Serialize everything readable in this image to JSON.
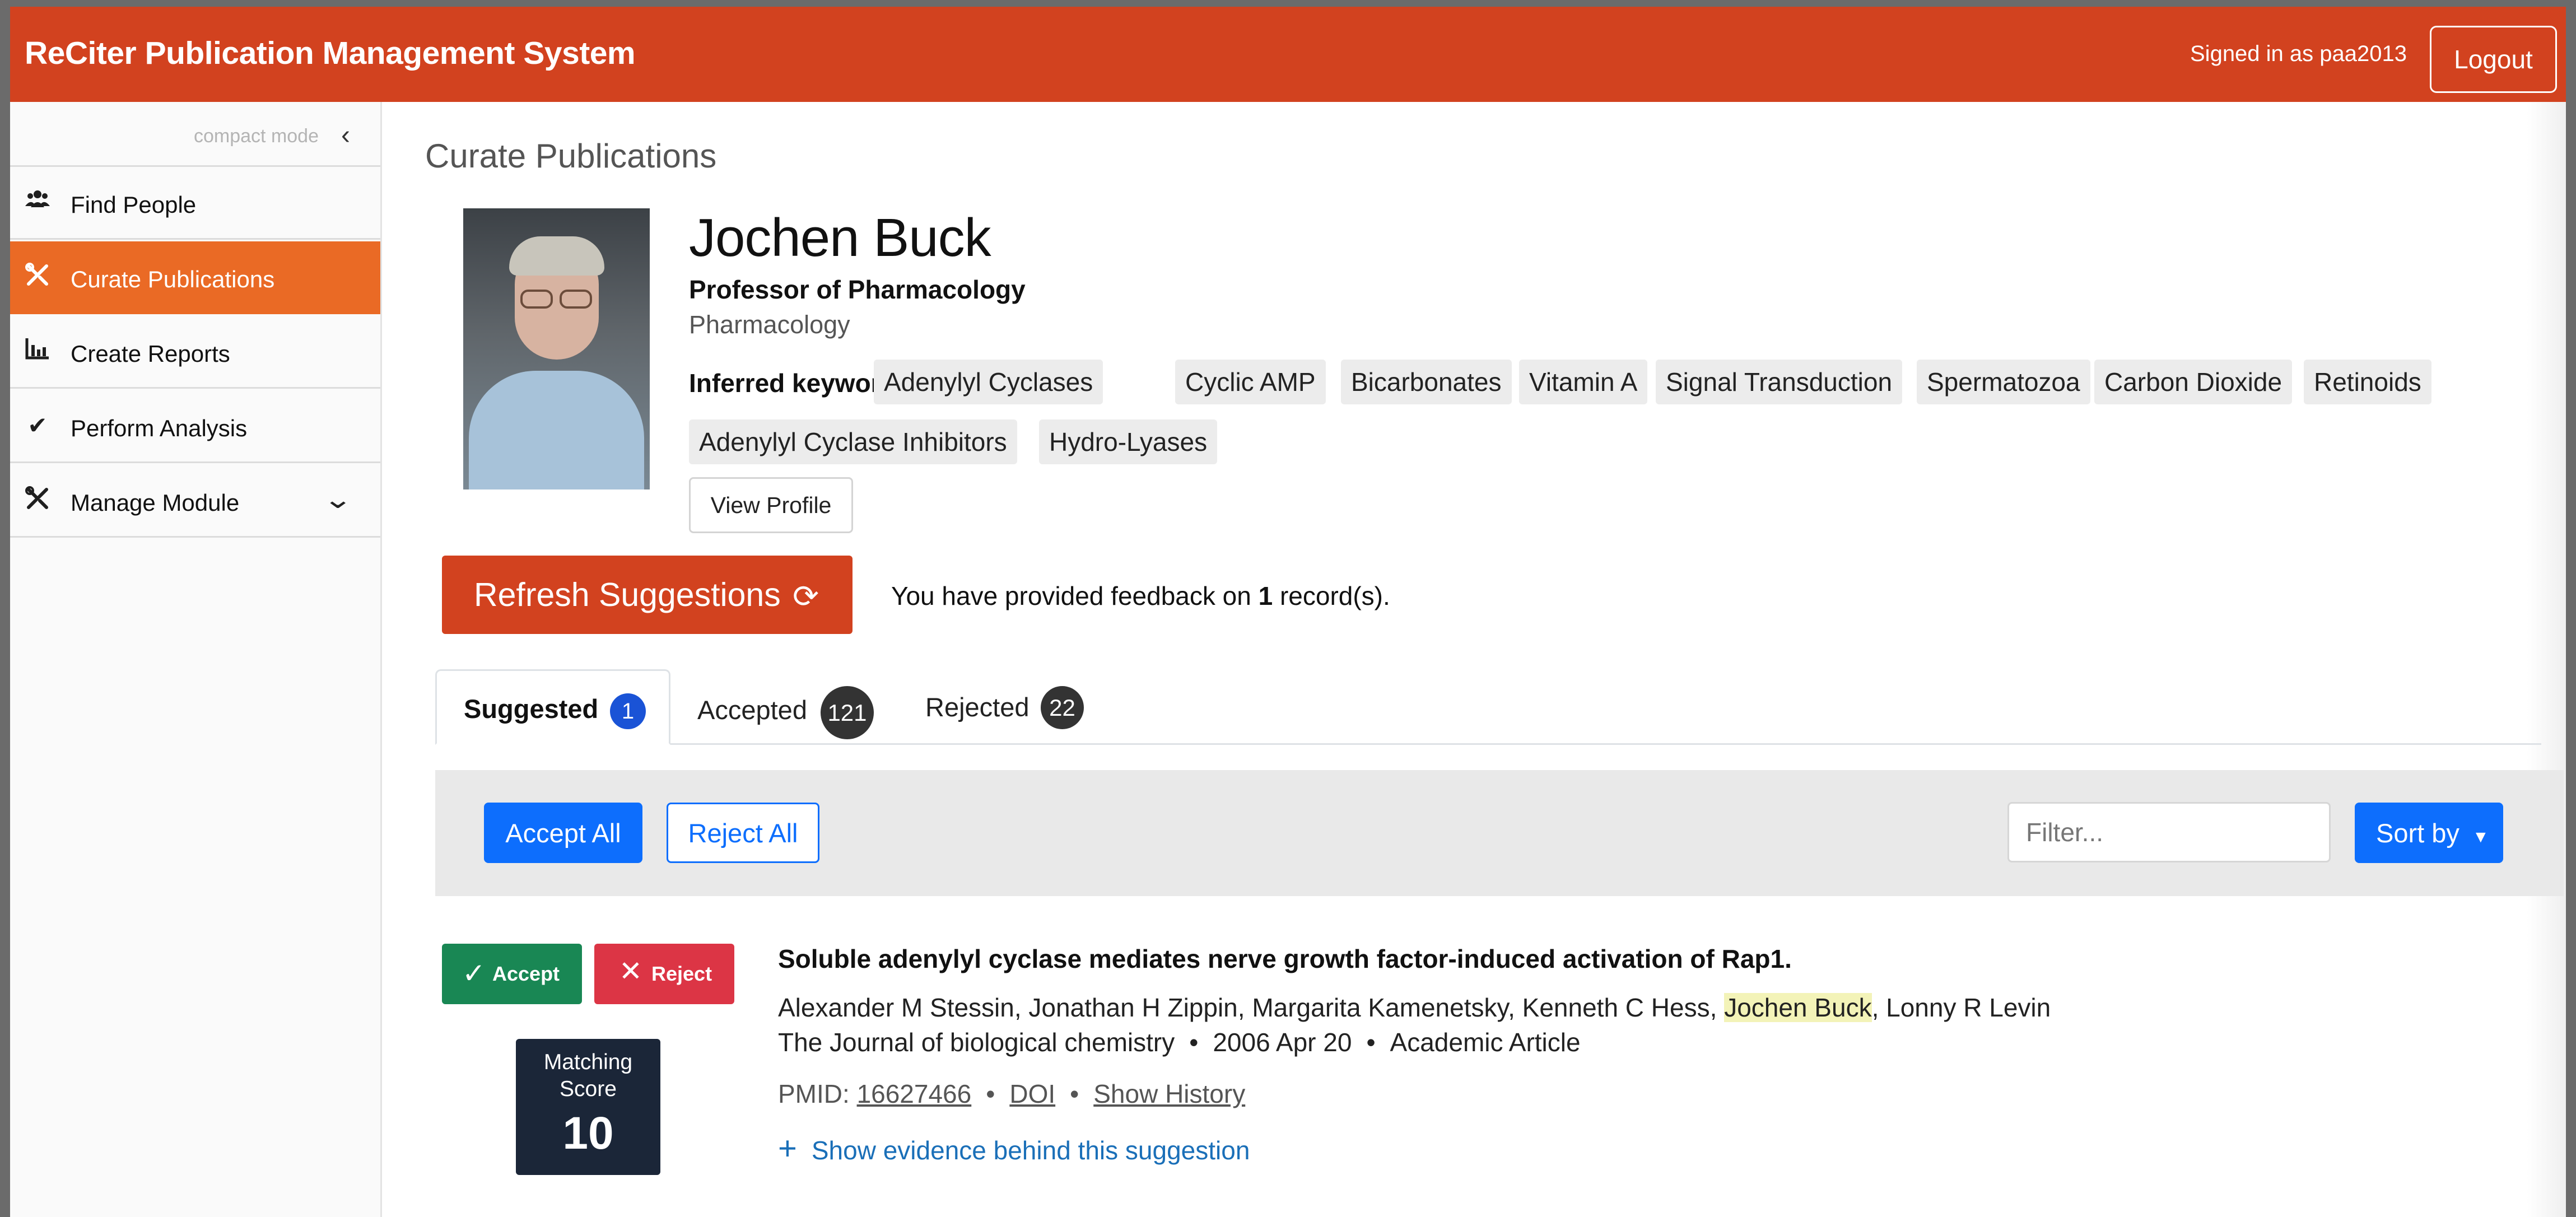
{
  "app": {
    "brand": "ReCiter Publication Management System",
    "signed_in": "Signed in as paa2013",
    "logout_label": "Logout"
  },
  "sidebar": {
    "compact_label": "compact mode",
    "items": [
      {
        "label": "Find People",
        "icon": "users-icon"
      },
      {
        "label": "Curate Publications",
        "icon": "tools-icon",
        "active": true
      },
      {
        "label": "Create Reports",
        "icon": "bar-chart-icon"
      },
      {
        "label": "Perform Analysis",
        "icon": "checkmark-icon"
      },
      {
        "label": "Manage Module",
        "icon": "tools-icon",
        "has_submenu": true
      }
    ]
  },
  "page": {
    "title": "Curate Publications"
  },
  "person": {
    "name": "Jochen Buck",
    "title": "Professor of Pharmacology",
    "department": "Pharmacology",
    "keywords_label": "Inferred keywords:",
    "keywords": [
      "Adenylyl Cyclases",
      "Cyclic AMP",
      "Bicarbonates",
      "Vitamin A",
      "Signal Transduction",
      "Spermatozoa",
      "Carbon Dioxide",
      "Retinoids",
      "Adenylyl Cyclase Inhibitors",
      "Hydro-Lyases"
    ],
    "view_profile_label": "View Profile"
  },
  "actions": {
    "refresh_label": "Refresh Suggestions",
    "feedback_prefix": "You have provided feedback on",
    "feedback_count": "1",
    "feedback_suffix": "record(s)."
  },
  "tabs": [
    {
      "label": "Suggested",
      "count": "1",
      "active": true
    },
    {
      "label": "Accepted",
      "count": "121"
    },
    {
      "label": "Rejected",
      "count": "22"
    }
  ],
  "toolbar": {
    "accept_all": "Accept All",
    "reject_all": "Reject All",
    "filter_placeholder": "Filter...",
    "sort_by": "Sort by"
  },
  "publication": {
    "accept_label": "Accept",
    "reject_label": "Reject",
    "score_label_line1": "Matching",
    "score_label_line2": "Score",
    "score": "10",
    "title": "Soluble adenylyl cyclase mediates nerve growth factor-induced activation of Rap1.",
    "authors_before": "Alexander M Stessin, Jonathan H Zippin, Margarita Kamenetsky, Kenneth C Hess, ",
    "authors_highlight": "Jochen Buck",
    "authors_after": ", Lonny R Levin",
    "journal": "The Journal of biological chemistry",
    "date": "2006 Apr 20",
    "type": "Academic Article",
    "pmid_label": "PMID:",
    "pmid": "16627466",
    "doi_label": "DOI",
    "history_label": "Show History",
    "evidence_label": "Show evidence behind this suggestion"
  },
  "colors": {
    "brand": "#d2421f",
    "sidebar_active": "#ea6a25",
    "primary": "#0d6efd",
    "accept": "#198754",
    "reject": "#dc3545",
    "score_bg": "#1b2638"
  }
}
